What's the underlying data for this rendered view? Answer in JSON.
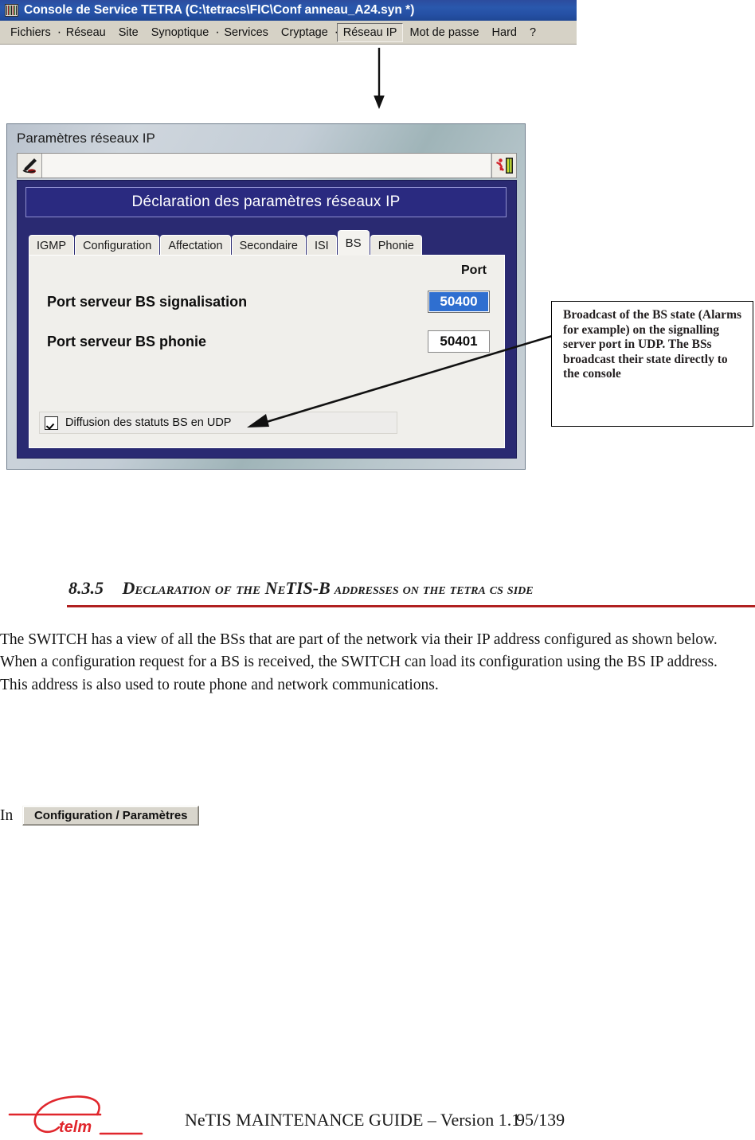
{
  "console_window": {
    "title": "Console de Service TETRA   (C:\\tetracs\\FIC\\Conf anneau_A24.syn *)",
    "icon": "server-rack-icon",
    "menu": [
      {
        "label": "Fichiers",
        "selected": false
      },
      {
        "label": "Réseau",
        "selected": false
      },
      {
        "label": "Site",
        "selected": false
      },
      {
        "label": "Synoptique",
        "selected": false
      },
      {
        "label": "Services",
        "selected": false
      },
      {
        "label": "Cryptage",
        "selected": false
      },
      {
        "label": "Réseau IP",
        "selected": true
      },
      {
        "label": "Mot de passe",
        "selected": false
      },
      {
        "label": "Hard",
        "selected": false
      },
      {
        "label": "?",
        "selected": false
      }
    ]
  },
  "ip_dialog": {
    "window_title": "Paramètres réseaux IP",
    "toolbar": {
      "pen_icon": "pen-write-icon",
      "exit_icon": "exit-running-man-icon",
      "address_field_value": ""
    },
    "banner": "Déclaration des paramètres réseaux IP",
    "tabs": [
      {
        "label": "IGMP",
        "active": false
      },
      {
        "label": "Configuration",
        "active": false
      },
      {
        "label": "Affectation",
        "active": false
      },
      {
        "label": "Secondaire",
        "active": false
      },
      {
        "label": "ISI",
        "active": false
      },
      {
        "label": "BS",
        "active": true
      },
      {
        "label": "Phonie",
        "active": false
      }
    ],
    "panel": {
      "column_header": "Port",
      "rows": [
        {
          "label": "Port serveur BS signalisation",
          "value": "50400",
          "focused": true
        },
        {
          "label": "Port serveur BS phonie",
          "value": "50401",
          "focused": false
        }
      ],
      "checkbox": {
        "label": "Diffusion des statuts BS en UDP",
        "checked": true
      }
    }
  },
  "callout": {
    "text": "Broadcast of the BS state (Alarms for example) on the signalling server port in UDP. The BSs broadcast their state directly to the console"
  },
  "section": {
    "number": "8.3.5",
    "title_part1": "Declaration of the ",
    "title_part2": "NeTIS-B",
    "title_part3": " addresses on the tetra cs side",
    "rule_color": "#b02020"
  },
  "body": {
    "p1": "The SWITCH has a view of all the BSs that are part of the network via their IP address configured as shown below.",
    "p2": "When a configuration request for a BS is received, the SWITCH can load its configuration using the BS IP address.",
    "p3": "This address is also used to route phone and network communications."
  },
  "in_row": {
    "prefix": "In",
    "button_label": "Configuration / Paramètres"
  },
  "footer": {
    "logo_text": "telm",
    "title": "NeTIS MAINTENANCE GUIDE – Version 1.1",
    "page": "95/139",
    "logo_color": "#e0262c"
  }
}
